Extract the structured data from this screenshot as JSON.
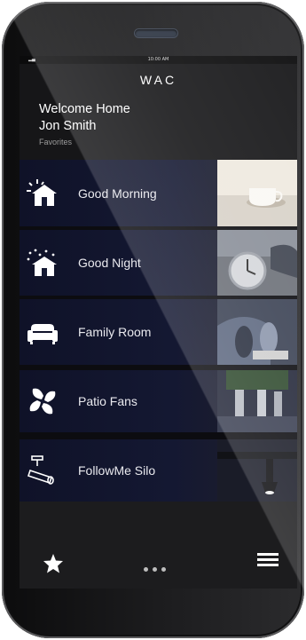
{
  "status_bar": {
    "time": "10:00 AM"
  },
  "header": {
    "logo": "WAC",
    "welcome_line1": "Welcome Home",
    "welcome_line2": "Jon Smith",
    "section": "Favorites"
  },
  "scenes": [
    {
      "label": "Good Morning",
      "icon": "sun-house-icon"
    },
    {
      "label": "Good Night",
      "icon": "night-house-icon"
    },
    {
      "label": "Family Room",
      "icon": "sofa-icon"
    },
    {
      "label": "Patio Fans",
      "icon": "fan-icon"
    },
    {
      "label": "FollowMe Silo",
      "icon": "spotlight-icon"
    }
  ],
  "bottom_nav": {
    "favorites_icon": "star-icon",
    "more_icon": "dots-icon",
    "menu_icon": "hamburger-icon"
  },
  "colors": {
    "scene_bg": "#141832",
    "header_bg": "#161618",
    "text_primary": "#ffffff",
    "text_secondary": "#9c9c9c"
  }
}
